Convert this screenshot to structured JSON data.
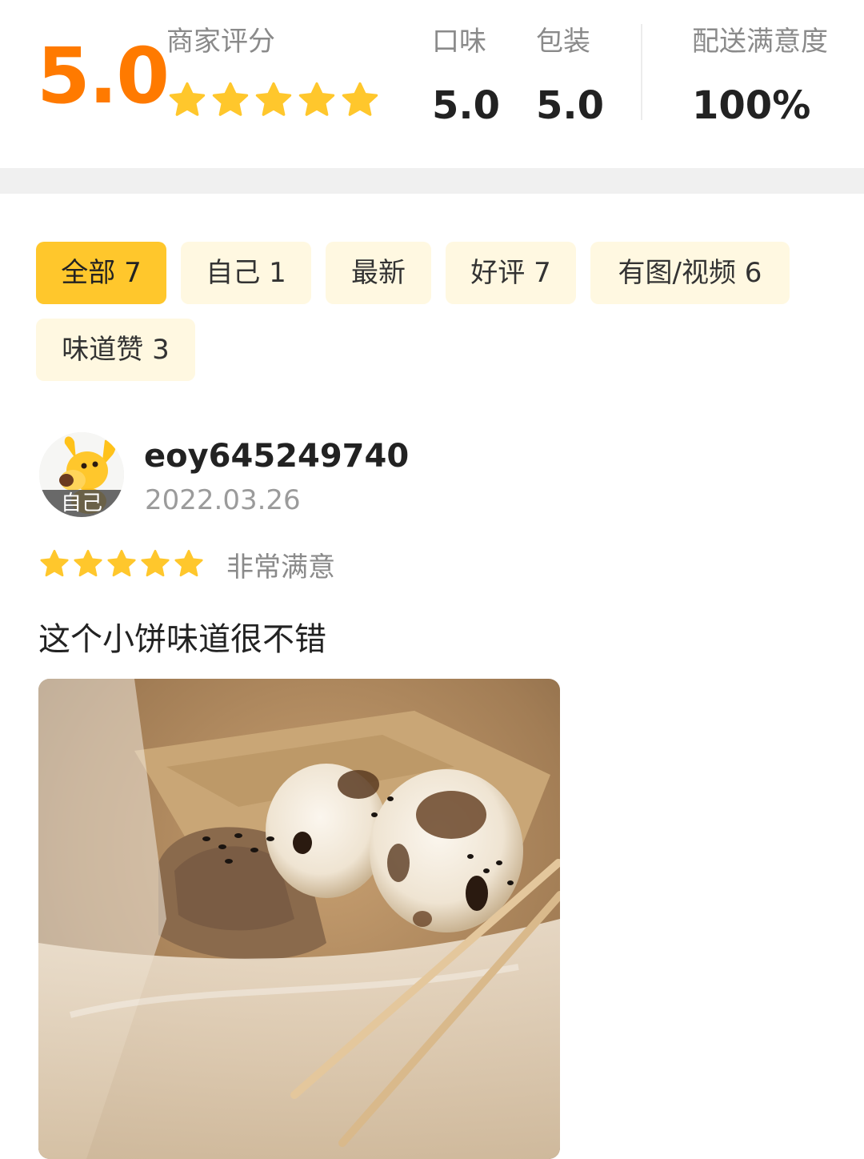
{
  "rating": {
    "overall": "5.0",
    "merchant_label": "商家评分",
    "stars": 5,
    "metrics": [
      {
        "label": "口味",
        "value": "5.0"
      },
      {
        "label": "包装",
        "value": "5.0"
      },
      {
        "label": "配送满意度",
        "value": "100%"
      }
    ]
  },
  "filters": [
    {
      "label": "全部 7",
      "active": true
    },
    {
      "label": "自己 1",
      "active": false
    },
    {
      "label": "最新",
      "active": false
    },
    {
      "label": "好评 7",
      "active": false
    },
    {
      "label": "有图/视频 6",
      "active": false
    },
    {
      "label": "味道赞 3",
      "active": false
    }
  ],
  "review": {
    "avatar_tag": "自己",
    "username": "eoy645249740",
    "date": "2022.03.26",
    "stars": 5,
    "satisfaction": "非常满意",
    "text": "这个小饼味道很不错"
  },
  "colors": {
    "score_orange": "#ff7a00",
    "star_yellow": "#ffc72c",
    "chip_active": "#ffc72c",
    "chip_inactive": "#fff8e1"
  }
}
